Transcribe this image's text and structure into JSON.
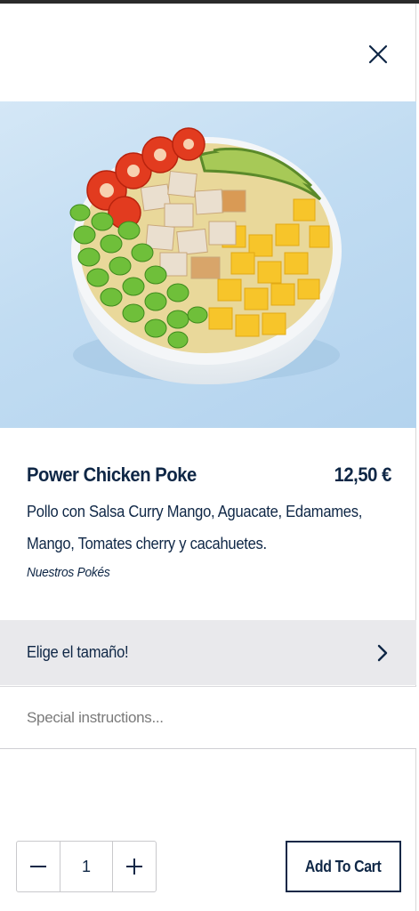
{
  "product": {
    "name": "Power Chicken Poke",
    "price": "12,50 €",
    "description": "Pollo con Salsa Curry Mango, Aguacate, Edamames, Mango, Tomates cherry y cacahuetes.",
    "category": "Nuestros Pokés"
  },
  "size_option": {
    "label": "Elige el tamaño!"
  },
  "instructions": {
    "placeholder": "Special instructions..."
  },
  "quantity": {
    "value": "1"
  },
  "cart": {
    "add_label": "Add To Cart"
  },
  "icons": {
    "close": "close-icon",
    "chevron": "chevron-right-icon",
    "minus": "minus-icon",
    "plus": "plus-icon"
  },
  "colors": {
    "brand_navy": "#0f2746",
    "size_row_bg": "#e9e9ec",
    "hero_bg": "#c1dcf2"
  }
}
